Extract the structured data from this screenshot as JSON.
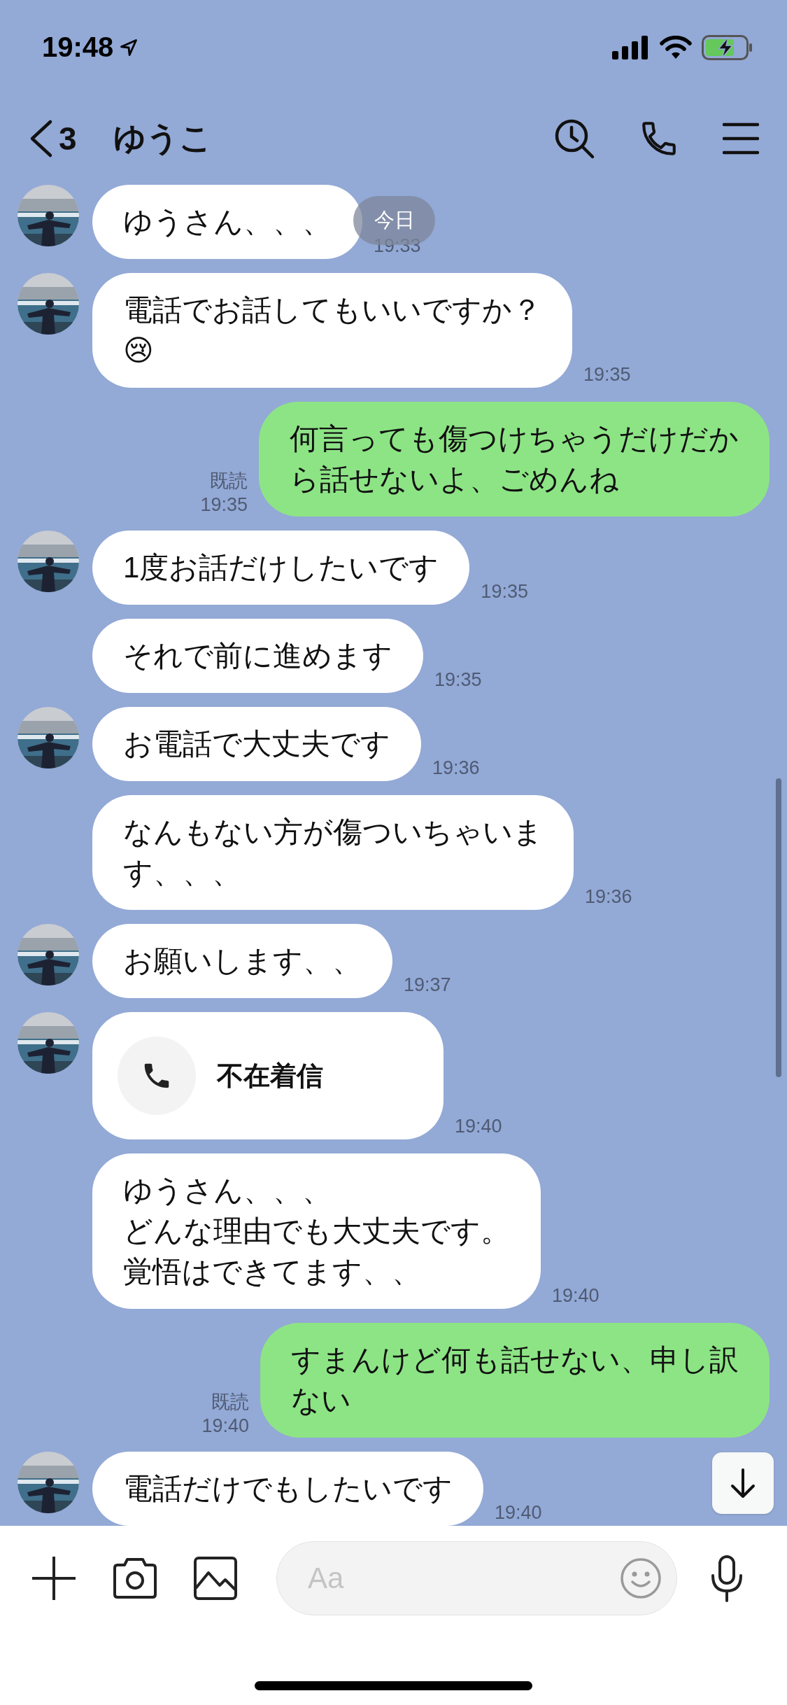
{
  "status_bar": {
    "time": "19:48"
  },
  "header": {
    "back_count": "3",
    "title": "ゆうこ"
  },
  "date_badge": "今日",
  "messages": [
    {
      "kind": "text",
      "outgoing": false,
      "avatar": true,
      "lines": [
        "ゆうさん、、、"
      ],
      "time": "19:33"
    },
    {
      "kind": "text",
      "outgoing": false,
      "avatar": true,
      "lines": [
        "電話でお話してもいいですか？",
        "😢"
      ],
      "time": "19:35"
    },
    {
      "kind": "text",
      "outgoing": true,
      "read": "既読",
      "lines": [
        "何言っても傷つけちゃうだけだか",
        "ら話せないよ、ごめんね"
      ],
      "time": "19:35"
    },
    {
      "kind": "text",
      "outgoing": false,
      "avatar": true,
      "lines": [
        "1度お話だけしたいです"
      ],
      "time": "19:35"
    },
    {
      "kind": "text",
      "outgoing": false,
      "avatar": false,
      "lines": [
        "それで前に進めます"
      ],
      "time": "19:35"
    },
    {
      "kind": "text",
      "outgoing": false,
      "avatar": true,
      "lines": [
        "お電話で大丈夫です"
      ],
      "time": "19:36"
    },
    {
      "kind": "text",
      "outgoing": false,
      "avatar": false,
      "lines": [
        "なんもない方が傷ついちゃいま",
        "す、、、"
      ],
      "time": "19:36"
    },
    {
      "kind": "text",
      "outgoing": false,
      "avatar": true,
      "lines": [
        "お願いします、、"
      ],
      "time": "19:37"
    },
    {
      "kind": "call",
      "outgoing": false,
      "avatar": true,
      "label": "不在着信",
      "time": "19:40"
    },
    {
      "kind": "text",
      "outgoing": false,
      "avatar": false,
      "lines": [
        "ゆうさん、、、",
        "どんな理由でも大丈夫です。",
        "覚悟はできてます、、"
      ],
      "time": "19:40"
    },
    {
      "kind": "text",
      "outgoing": true,
      "read": "既読",
      "lines": [
        "すまんけど何も話せない、申し訳",
        "ない"
      ],
      "time": "19:40"
    },
    {
      "kind": "text",
      "outgoing": false,
      "avatar": true,
      "lines": [
        "電話だけでもしたいです"
      ],
      "time": "19:40"
    }
  ],
  "composer": {
    "placeholder": "Aa"
  }
}
